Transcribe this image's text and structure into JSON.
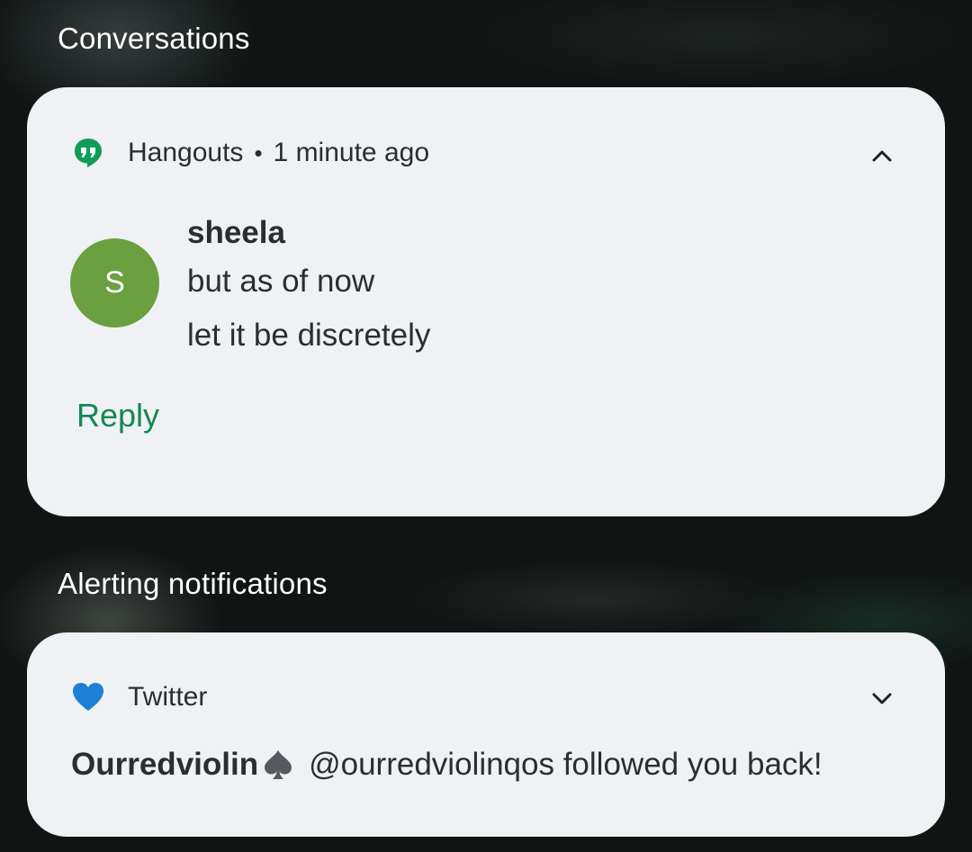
{
  "sections": {
    "conversations_title": "Conversations",
    "alerting_title": "Alerting notifications"
  },
  "hangouts": {
    "app_name": "Hangouts",
    "separator": "•",
    "time": "1 minute ago",
    "icon": "hangouts-icon",
    "avatar_initial": "S",
    "avatar_color": "#6aa040",
    "sender": "sheela",
    "messages": [
      "but as of now",
      "let it be discretely"
    ],
    "reply_label": "Reply",
    "accent_color": "#158853"
  },
  "twitter": {
    "app_name": "Twitter",
    "icon": "blue-heart-icon",
    "user": "Ourredviolin",
    "user_emoji": "spade-icon",
    "text": "@ourredviolinqos followed you back!"
  }
}
